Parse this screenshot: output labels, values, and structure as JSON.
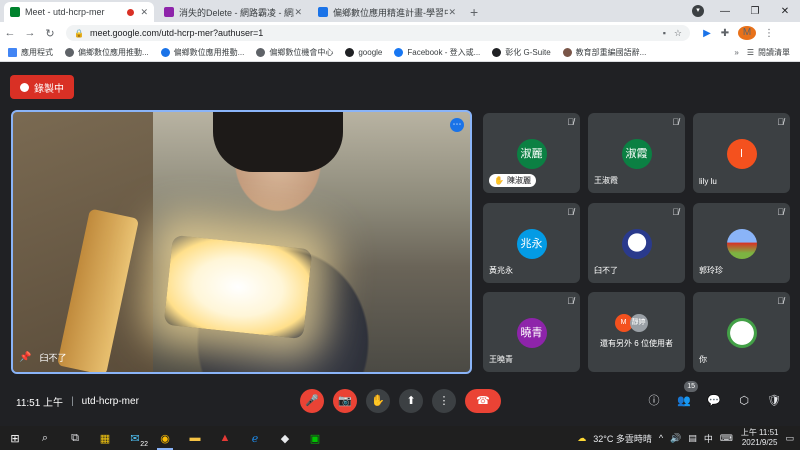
{
  "browser": {
    "tabs": [
      {
        "title": "Meet - utd-hcrp-mer",
        "active": true
      },
      {
        "title": "消失的Delete - 網路霸凌 - 網路素",
        "active": false
      },
      {
        "title": "偏鄉數位應用精進計畫-學習中心",
        "active": false
      }
    ],
    "new_tab": "+",
    "url": "meet.google.com/utd-hcrp-mer?authuser=1",
    "profile_initial": "M",
    "bookmarks": [
      "應用程式",
      "偏鄉數位應用推動...",
      "偏鄉數位應用推動...",
      "偏鄉數位機會中心",
      "google",
      "Facebook - 登入或...",
      "彰化 G-Suite",
      "教育部重編國語辭..."
    ],
    "bookmarks_more": "»",
    "reading_list": "閱讀清單"
  },
  "meet": {
    "recording_label": "錄製中",
    "main_video_name": "臼不了",
    "tiles": [
      {
        "initials": "淑麗",
        "name": "陳淑麗",
        "color": "#0b8043",
        "hand_raised": true
      },
      {
        "initials": "淑霞",
        "name": "王淑霞",
        "color": "#0b8043",
        "hand_raised": false
      },
      {
        "initials": "l",
        "name": "lily lu",
        "color": "#f4511e",
        "hand_raised": false
      },
      {
        "initials": "兆永",
        "name": "黃兆永",
        "color": "#039be5",
        "hand_raised": false
      },
      {
        "initials": "",
        "name": "臼不了",
        "color": "#e8eaed",
        "hand_raised": false
      },
      {
        "initials": "",
        "name": "郭玲珍",
        "color": "#c0ca33",
        "hand_raised": false
      },
      {
        "initials": "曉青",
        "name": "王曉青",
        "color": "#8e24aa",
        "hand_raised": false
      },
      {
        "initials": "",
        "name": "",
        "color": "#3c4043",
        "hand_raised": false
      },
      {
        "initials": "",
        "name": "你",
        "color": "#ffffff",
        "hand_raised": false
      }
    ],
    "others": {
      "avatar1": "M",
      "avatar2": "靜婷",
      "text": "還有另外 6 位使用者"
    },
    "time": "11:51 上午",
    "meeting_code": "utd-hcrp-mer",
    "participants_count": "15"
  },
  "taskbar": {
    "weather": "32°C 多雲時晴",
    "ime": "中",
    "time": "上午 11:51",
    "date": "2021/9/25",
    "notification_count": "22"
  }
}
